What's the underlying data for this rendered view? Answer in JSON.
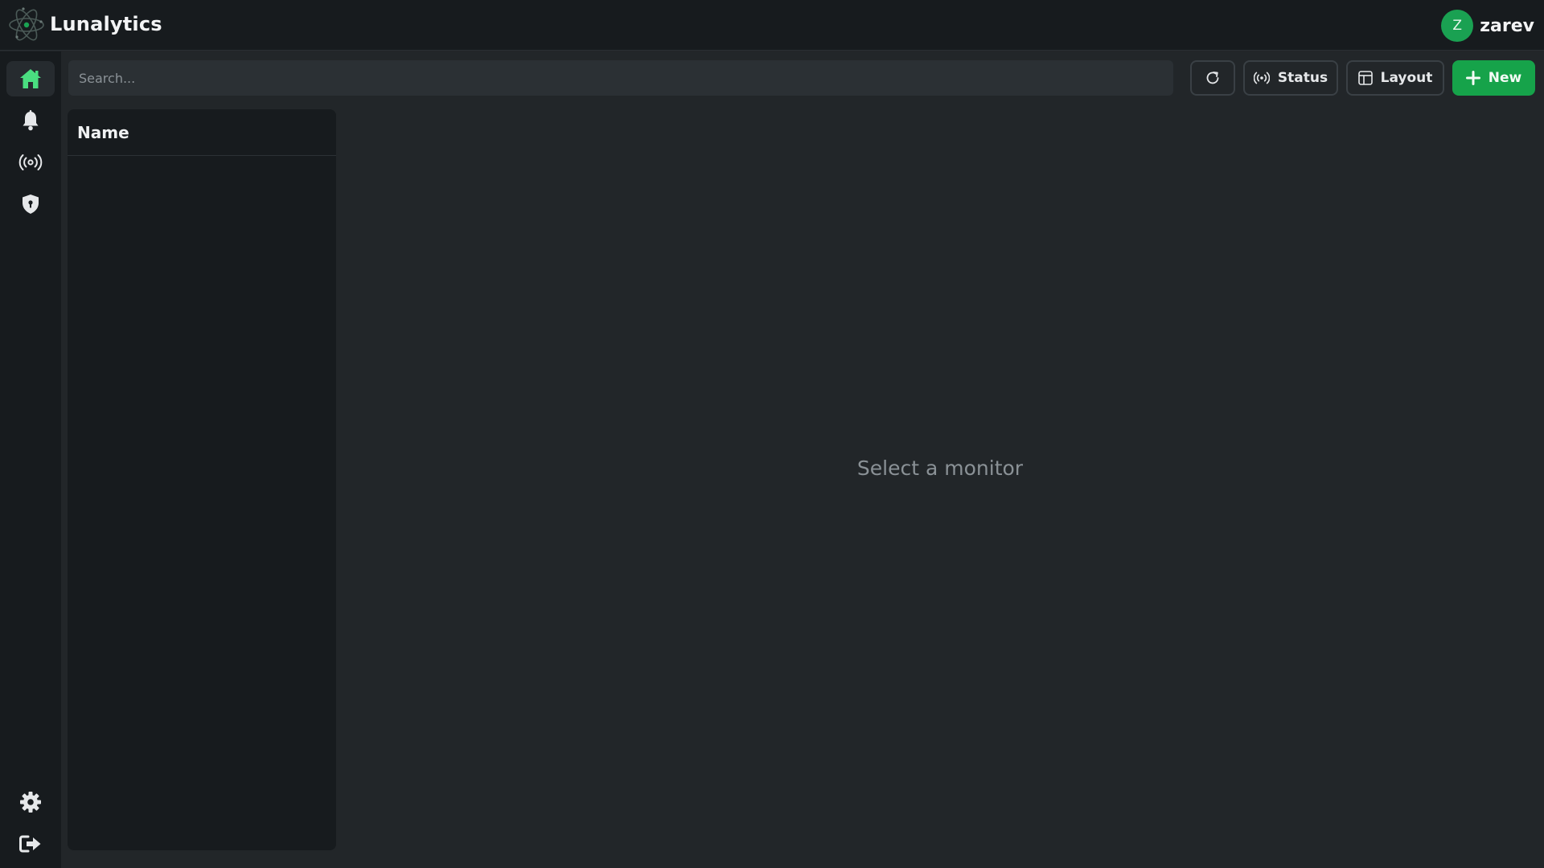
{
  "app": {
    "title": "Lunalytics"
  },
  "user": {
    "initial": "Z",
    "name": "zarev"
  },
  "sidebar": {
    "items": [
      {
        "icon": "home-icon",
        "active": true
      },
      {
        "icon": "bell-icon",
        "active": false
      },
      {
        "icon": "broadcast-icon",
        "active": false
      },
      {
        "icon": "shield-icon",
        "active": false
      }
    ],
    "bottom": [
      {
        "icon": "gear-icon"
      },
      {
        "icon": "logout-icon"
      }
    ]
  },
  "search": {
    "placeholder": "Search...",
    "value": ""
  },
  "toolbar": {
    "refresh_icon": "refresh-icon",
    "status_label": "Status",
    "layout_label": "Layout",
    "new_label": "New"
  },
  "monitor_list": {
    "header": "Name",
    "items": []
  },
  "main": {
    "empty_message": "Select a monitor"
  },
  "colors": {
    "accent": "#16a34a",
    "active_icon": "#4ade80",
    "background": "#222629",
    "panel": "#171b1e"
  }
}
